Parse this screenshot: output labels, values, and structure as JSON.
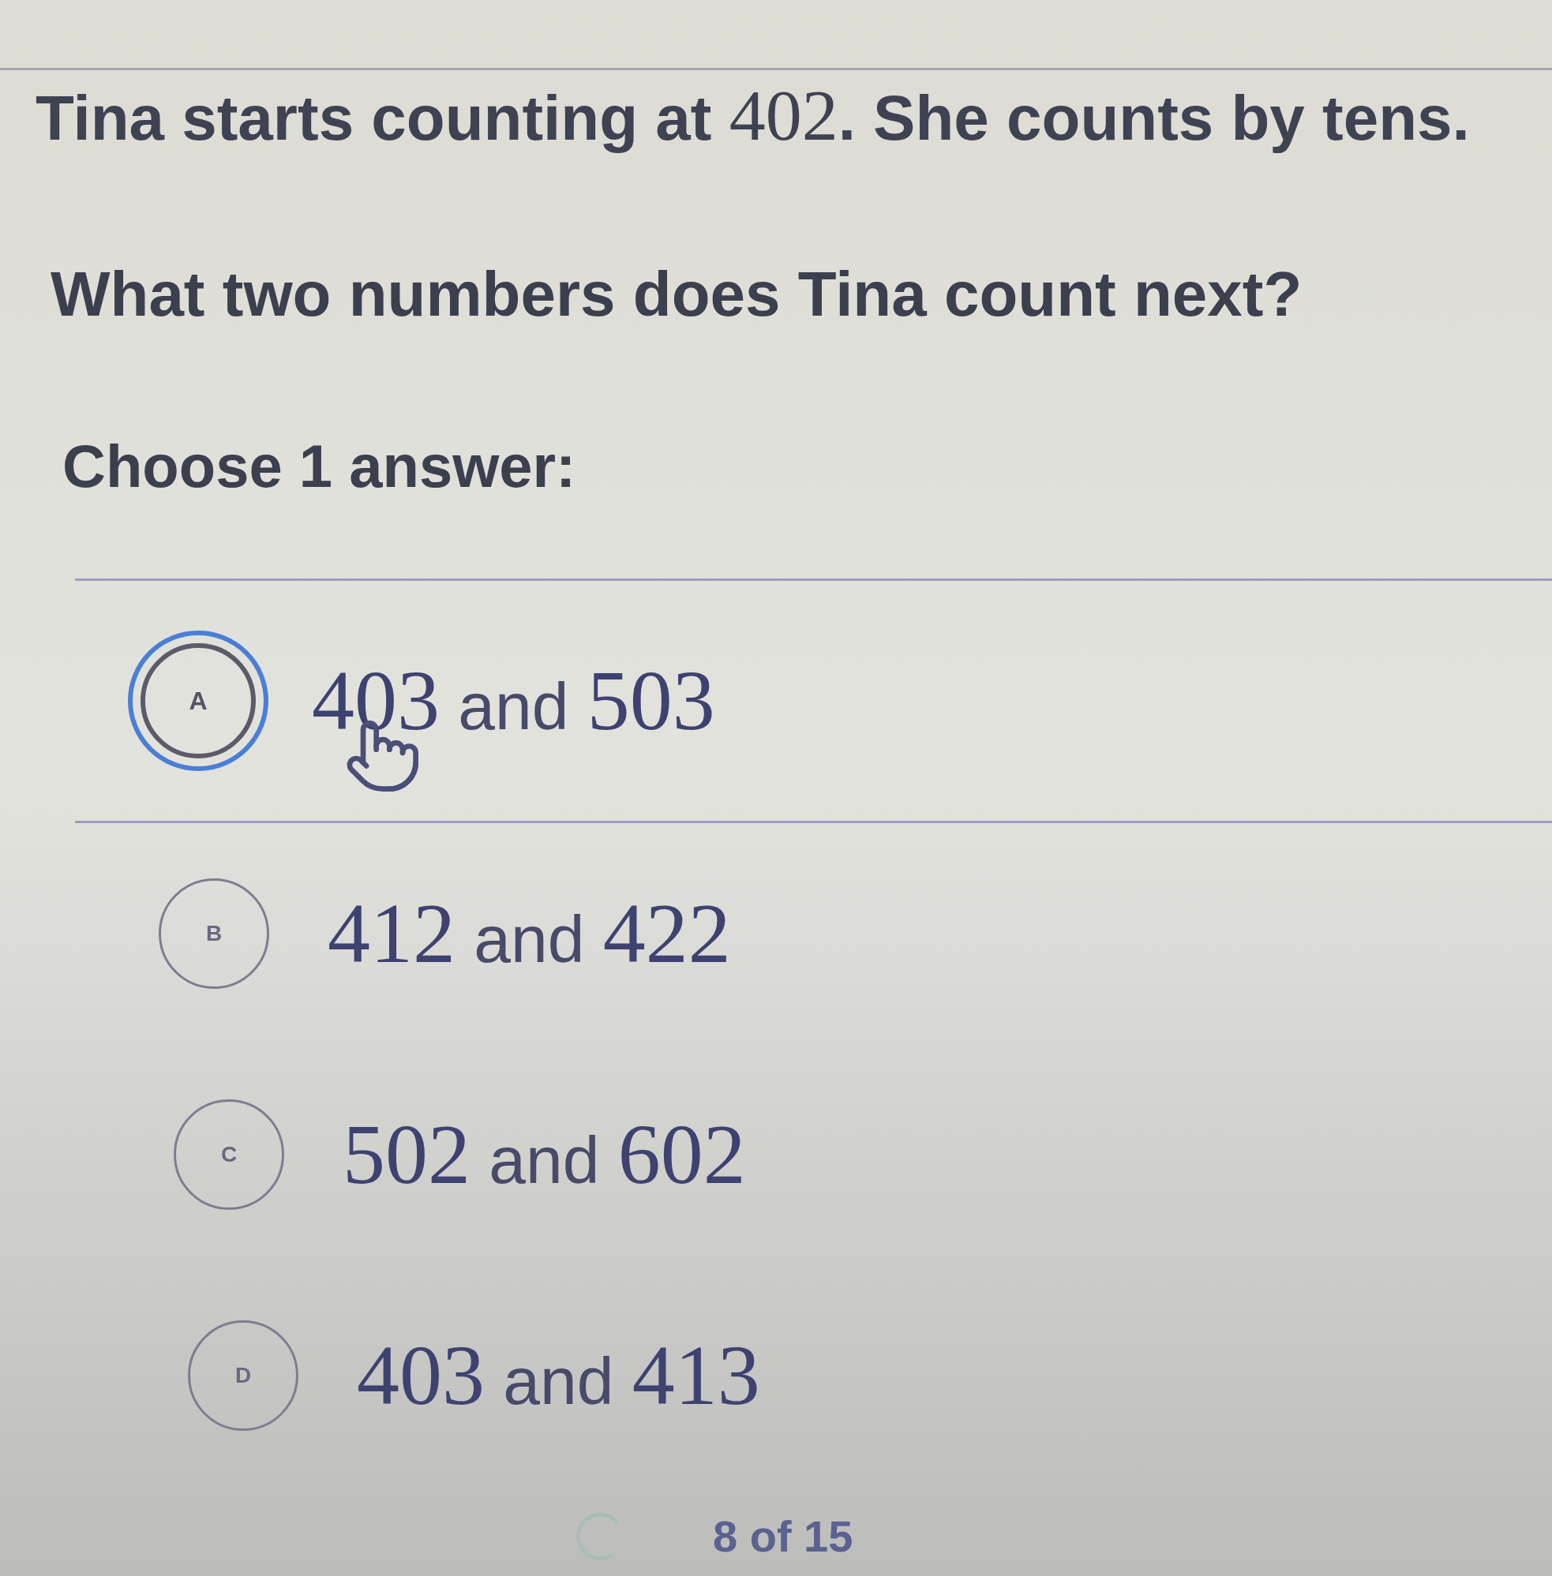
{
  "question": {
    "statement": [
      {
        "kind": "text",
        "text": "Tina starts counting at "
      },
      {
        "kind": "math",
        "text": "402"
      },
      {
        "kind": "text",
        "text": ". She counts by tens."
      }
    ],
    "prompt": "What two numbers does Tina count next?"
  },
  "instruction": "Choose 1 answer:",
  "choices": [
    {
      "letter": "A",
      "selected": true,
      "segments": [
        {
          "kind": "math",
          "text": "403"
        },
        {
          "kind": "text",
          "text": " and "
        },
        {
          "kind": "math",
          "text": "503"
        }
      ]
    },
    {
      "letter": "B",
      "selected": false,
      "segments": [
        {
          "kind": "math",
          "text": "412"
        },
        {
          "kind": "text",
          "text": " and "
        },
        {
          "kind": "math",
          "text": "422"
        }
      ]
    },
    {
      "letter": "C",
      "selected": false,
      "segments": [
        {
          "kind": "math",
          "text": "502"
        },
        {
          "kind": "text",
          "text": " and "
        },
        {
          "kind": "math",
          "text": "602"
        }
      ]
    },
    {
      "letter": "D",
      "selected": false,
      "segments": [
        {
          "kind": "math",
          "text": "403"
        },
        {
          "kind": "text",
          "text": " and "
        },
        {
          "kind": "math",
          "text": "413"
        }
      ]
    }
  ],
  "progress": "8 of 15"
}
